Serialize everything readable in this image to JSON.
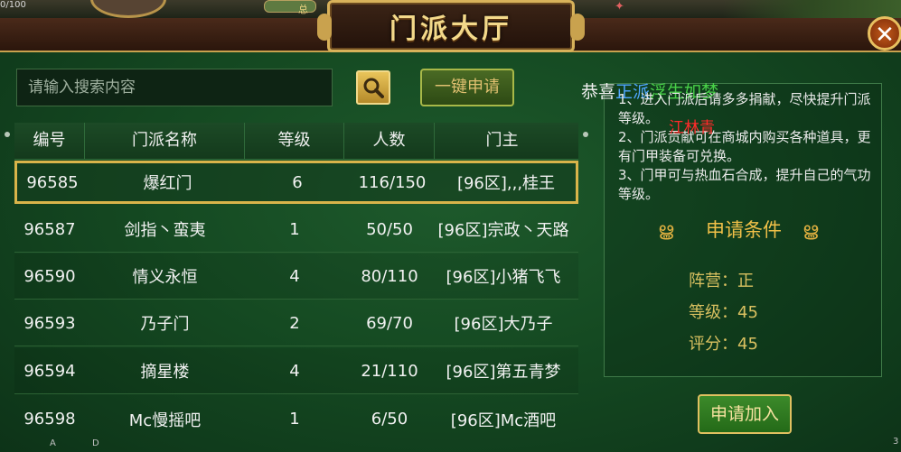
{
  "hud": {
    "counter": "0/100",
    "bell": "总"
  },
  "dialog": {
    "title": "门派大厅",
    "close_symbol": "✕"
  },
  "search": {
    "placeholder": "请输入搜索内容",
    "apply_one_label": "一键申请"
  },
  "table": {
    "headers": [
      "编号",
      "门派名称",
      "等级",
      "人数",
      "门主"
    ],
    "rows": [
      {
        "id": "96585",
        "name": "爆红门",
        "level": "6",
        "members": "116/150",
        "leader": "[96区],,,桂王"
      },
      {
        "id": "96587",
        "name": "剑指丶蛮夷",
        "level": "1",
        "members": "50/50",
        "leader": "[96区]宗政丶天路"
      },
      {
        "id": "96590",
        "name": "情义永恒",
        "level": "4",
        "members": "80/110",
        "leader": "[96区]小猪飞飞"
      },
      {
        "id": "96593",
        "name": "乃子门",
        "level": "2",
        "members": "69/70",
        "leader": "[96区]大乃子"
      },
      {
        "id": "96594",
        "name": "摘星楼",
        "level": "4",
        "members": "21/110",
        "leader": "[96区]第五青梦"
      },
      {
        "id": "96598",
        "name": "Mc慢摇吧",
        "level": "1",
        "members": "6/50",
        "leader": "[96区]Mc酒吧"
      }
    ]
  },
  "announcement": {
    "prefix": "恭喜",
    "sect": "正派",
    "player": "浮生如梦",
    "red_name": "江林青"
  },
  "info": {
    "line1": "1、进入门派后请多多捐献，尽快提升门派等级。",
    "line2": "2、门派贡献可在商城内购买各种道具，更有门甲装备可兑换。",
    "line3": "3、门甲可与热血石合成，提升自己的气功等级。"
  },
  "conditions": {
    "title": "申请条件",
    "faction": "阵营：正",
    "level": "等级：45",
    "score": "评分：45"
  },
  "join_label": "申请加入",
  "corner": {
    "a": "A",
    "d": "D",
    "three": "3"
  }
}
